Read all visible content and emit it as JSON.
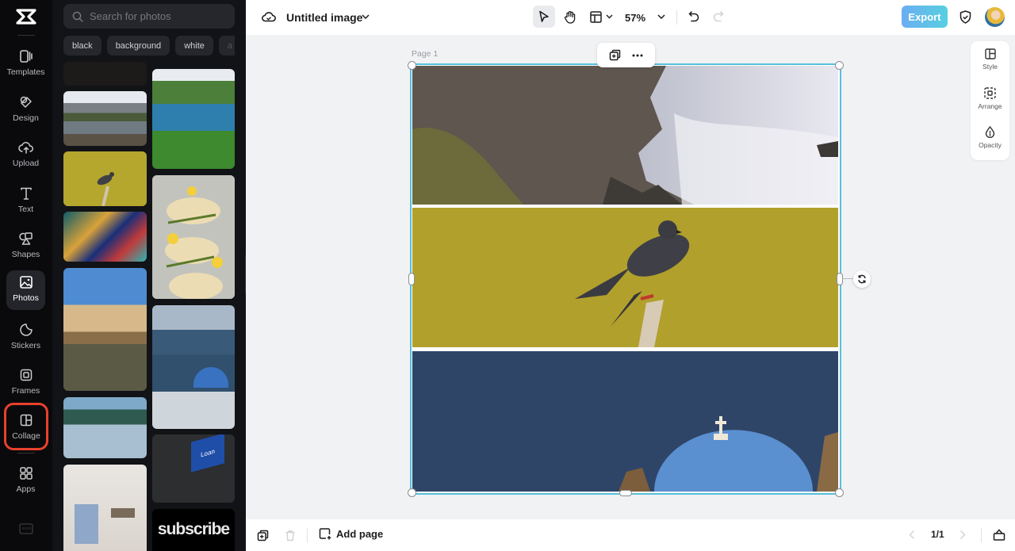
{
  "rail": {
    "logo": "capcut-logo",
    "items": [
      {
        "label": "Templates",
        "icon": "templates-icon"
      },
      {
        "label": "Design",
        "icon": "design-icon"
      },
      {
        "label": "Upload",
        "icon": "upload-icon"
      },
      {
        "label": "Text",
        "icon": "text-icon"
      },
      {
        "label": "Shapes",
        "icon": "shapes-icon"
      },
      {
        "label": "Photos",
        "icon": "photos-icon",
        "active": true
      },
      {
        "label": "Stickers",
        "icon": "stickers-icon"
      },
      {
        "label": "Frames",
        "icon": "frames-icon"
      },
      {
        "label": "Collage",
        "icon": "collage-icon",
        "highlighted": true
      },
      {
        "label": "Apps",
        "icon": "apps-icon"
      }
    ]
  },
  "panel": {
    "search_placeholder": "Search for photos",
    "search_value": "",
    "chips": [
      "black",
      "background",
      "white",
      "a"
    ],
    "thumbnails": [
      {
        "alt": "dark texture"
      },
      {
        "alt": "mountain lake"
      },
      {
        "alt": "river valley"
      },
      {
        "alt": "pigeon on branch"
      },
      {
        "alt": "baked chicken with lemons"
      },
      {
        "alt": "abstract colorful swirls"
      },
      {
        "alt": "Ponte Vecchio Florence"
      },
      {
        "alt": "Santorini blue dome"
      },
      {
        "alt": "lake reflection"
      },
      {
        "alt": "Loan keyboard key"
      },
      {
        "alt": "wardrobe closet"
      },
      {
        "alt": "subscribe"
      }
    ],
    "loan_key_text": "Loan",
    "subscribe_text": "subscribe"
  },
  "topbar": {
    "title": "Untitled image",
    "zoom": "57%",
    "export_label": "Export",
    "colors": {
      "export_start": "#6aaef2",
      "export_end": "#58cfe0"
    }
  },
  "canvas": {
    "page_label": "Page 1",
    "collage_cells": [
      "coastal cliffs and waves",
      "pigeon on branch with yellow background",
      "Santorini blue dome over sea"
    ],
    "selection_color": "#55c0db"
  },
  "side_tools": [
    {
      "label": "Style",
      "icon": "style-icon"
    },
    {
      "label": "Arrange",
      "icon": "arrange-icon"
    },
    {
      "label": "Opacity",
      "icon": "opacity-icon"
    }
  ],
  "bottombar": {
    "add_page_label": "Add page",
    "page_indicator": "1/1"
  }
}
